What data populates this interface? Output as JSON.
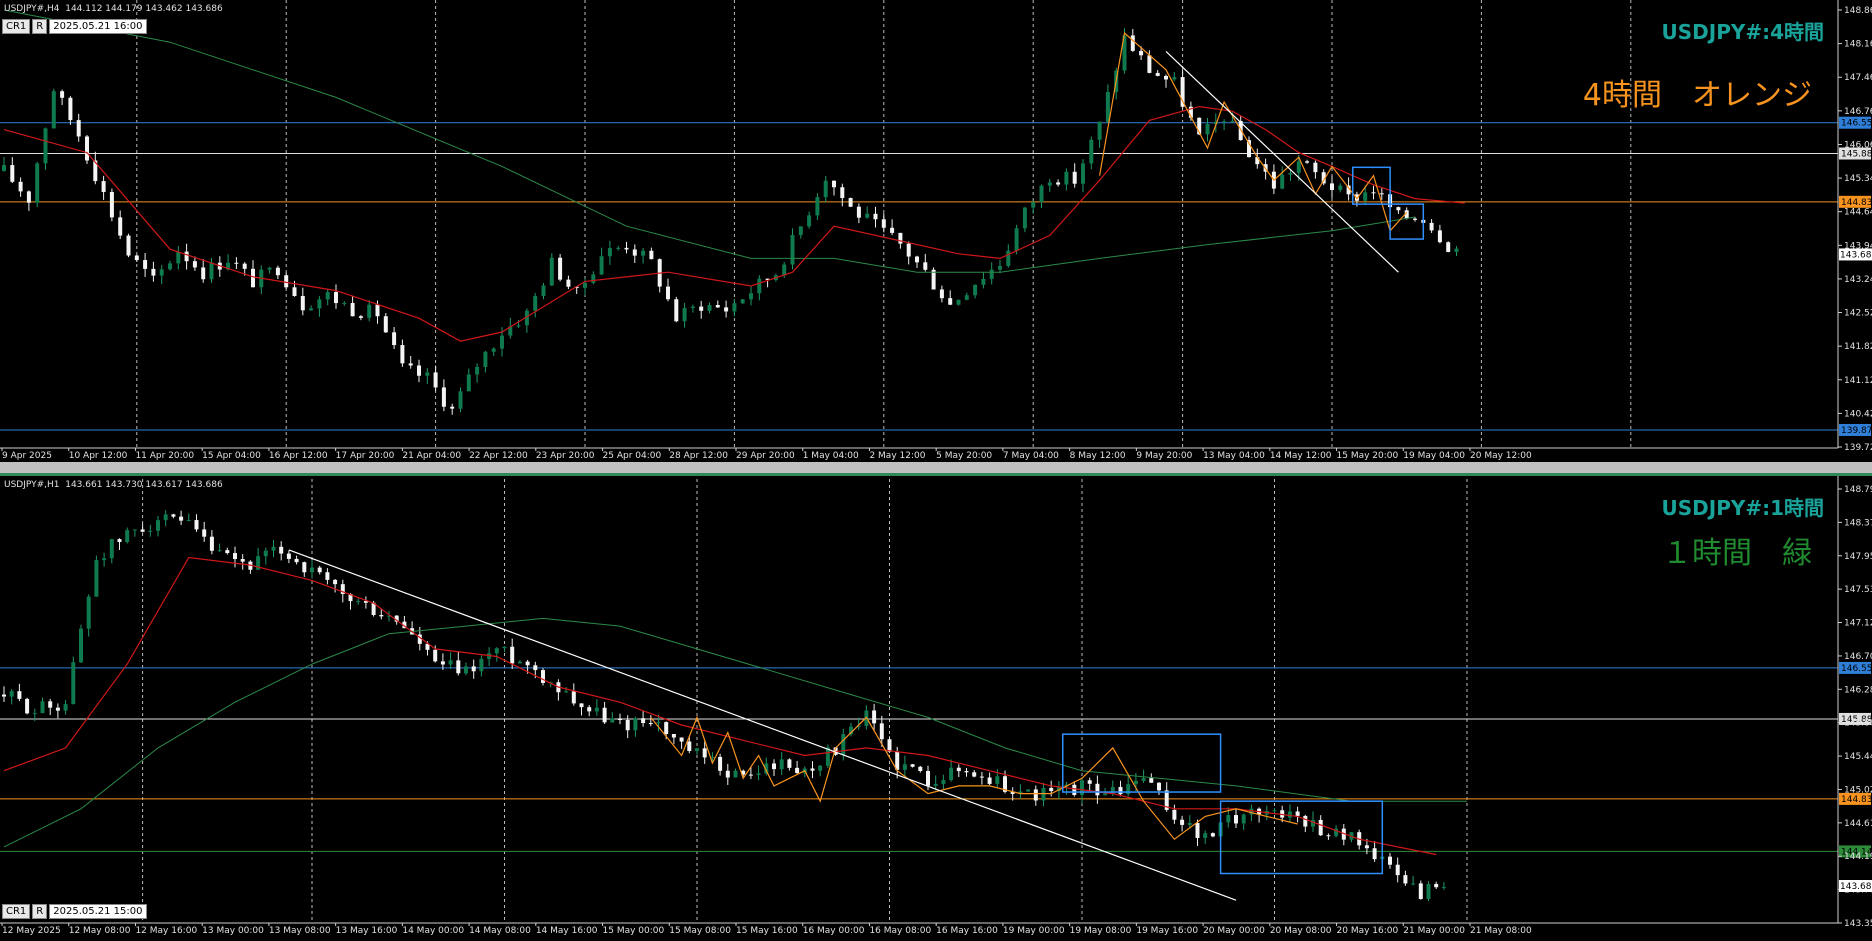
{
  "panels": [
    {
      "id": "h4",
      "header": "USDJPY#,H4  144.112 144.179 143.462 143.686",
      "tag_cr": "CR1",
      "tag_r": "R",
      "tag_datetime": "2025.05.21 16:00",
      "title": "USDJPY#:4時間",
      "note": "4時間　オレンジ",
      "note_color": "#f7931e",
      "chart_data": {
        "type": "candlestick",
        "ylim": [
          139.5,
          149.0
        ],
        "y_ticks": [
          "148.86",
          "148.16",
          "147.46",
          "146.76",
          "146.06",
          "145.34",
          "144.64",
          "143.94",
          "143.24",
          "142.52",
          "141.82",
          "141.12",
          "140.42",
          "139.72"
        ],
        "x_labels": [
          "9 Apr 2025",
          "10 Apr 12:00",
          "11 Apr 20:00",
          "15 Apr 04:00",
          "16 Apr 12:00",
          "17 Apr 20:00",
          "21 Apr 04:00",
          "22 Apr 12:00",
          "23 Apr 20:00",
          "25 Apr 04:00",
          "28 Apr 12:00",
          "29 Apr 20:00",
          "1 May 04:00",
          "2 May 12:00",
          "5 May 20:00",
          "7 May 04:00",
          "8 May 12:00",
          "9 May 20:00",
          "13 May 04:00",
          "14 May 12:00",
          "15 May 20:00",
          "19 May 04:00",
          "20 May 12:00"
        ],
        "hlines": [
          {
            "price": 146.55,
            "label": "146.55",
            "color": "#2f7fd8"
          },
          {
            "price": 145.88,
            "label": "145.88",
            "color": "#e0e0e0"
          },
          {
            "price": 144.83,
            "label": "144.83",
            "color": "#f7931e"
          },
          {
            "price": 139.87,
            "label": "139.87",
            "color": "#2f7fd8"
          }
        ],
        "last_price": {
          "price": 143.686,
          "label": "143.686"
        },
        "close_path": [
          [
            0,
            145.5
          ],
          [
            3,
            144.9
          ],
          [
            6,
            147.3
          ],
          [
            9,
            146.3
          ],
          [
            12,
            145.0
          ],
          [
            15,
            143.7
          ],
          [
            18,
            143.1
          ],
          [
            21,
            143.8
          ],
          [
            24,
            143.3
          ],
          [
            27,
            143.6
          ],
          [
            30,
            143.1
          ],
          [
            33,
            143.4
          ],
          [
            36,
            142.6
          ],
          [
            39,
            142.8
          ],
          [
            42,
            142.5
          ],
          [
            45,
            142.4
          ],
          [
            48,
            141.2
          ],
          [
            51,
            141.0
          ],
          [
            54,
            140.3
          ],
          [
            57,
            141.3
          ],
          [
            60,
            142.0
          ],
          [
            63,
            142.4
          ],
          [
            66,
            143.5
          ],
          [
            69,
            142.8
          ],
          [
            72,
            143.7
          ],
          [
            75,
            143.9
          ],
          [
            78,
            143.5
          ],
          [
            81,
            142.3
          ],
          [
            84,
            142.6
          ],
          [
            87,
            142.5
          ],
          [
            90,
            142.9
          ],
          [
            93,
            143.3
          ],
          [
            96,
            144.3
          ],
          [
            99,
            145.4
          ],
          [
            102,
            144.7
          ],
          [
            105,
            144.3
          ],
          [
            108,
            143.9
          ],
          [
            111,
            143.3
          ],
          [
            114,
            142.6
          ],
          [
            117,
            143.1
          ],
          [
            120,
            143.5
          ],
          [
            123,
            144.6
          ],
          [
            126,
            145.4
          ],
          [
            129,
            145.3
          ],
          [
            132,
            146.5
          ],
          [
            135,
            148.4
          ],
          [
            138,
            147.7
          ],
          [
            141,
            147.4
          ],
          [
            144,
            146.2
          ],
          [
            147,
            146.7
          ],
          [
            150,
            145.9
          ],
          [
            153,
            145.2
          ],
          [
            156,
            145.7
          ],
          [
            159,
            145.3
          ],
          [
            162,
            144.9
          ],
          [
            165,
            145.1
          ],
          [
            168,
            144.5
          ],
          [
            171,
            144.5
          ],
          [
            174,
            143.9
          ],
          [
            176,
            143.7
          ]
        ],
        "ema_red": [
          [
            0,
            146.4
          ],
          [
            10,
            145.9
          ],
          [
            20,
            143.8
          ],
          [
            30,
            143.2
          ],
          [
            40,
            142.9
          ],
          [
            50,
            142.3
          ],
          [
            55,
            141.8
          ],
          [
            60,
            142.0
          ],
          [
            70,
            143.1
          ],
          [
            80,
            143.3
          ],
          [
            90,
            143.0
          ],
          [
            95,
            143.3
          ],
          [
            100,
            144.3
          ],
          [
            110,
            143.9
          ],
          [
            115,
            143.7
          ],
          [
            120,
            143.6
          ],
          [
            126,
            144.1
          ],
          [
            132,
            145.3
          ],
          [
            138,
            146.6
          ],
          [
            144,
            146.9
          ],
          [
            148,
            146.8
          ],
          [
            152,
            146.4
          ],
          [
            156,
            145.9
          ],
          [
            160,
            145.6
          ],
          [
            165,
            145.2
          ],
          [
            170,
            144.9
          ],
          [
            176,
            144.8
          ]
        ],
        "sma_green": [
          [
            0,
            149.0
          ],
          [
            20,
            148.3
          ],
          [
            40,
            147.1
          ],
          [
            60,
            145.6
          ],
          [
            75,
            144.3
          ],
          [
            90,
            143.6
          ],
          [
            100,
            143.6
          ],
          [
            110,
            143.3
          ],
          [
            120,
            143.3
          ],
          [
            132,
            143.6
          ],
          [
            145,
            143.9
          ],
          [
            160,
            144.2
          ],
          [
            170,
            144.5
          ]
        ],
        "trendline": [
          [
            140,
            148.1
          ],
          [
            168,
            143.3
          ]
        ],
        "zigzag": [
          [
            132,
            145.4
          ],
          [
            135,
            148.5
          ],
          [
            140,
            147.7
          ],
          [
            145,
            146.0
          ],
          [
            147,
            147.0
          ],
          [
            151,
            145.8
          ],
          [
            153,
            145.3
          ],
          [
            156,
            145.8
          ],
          [
            158,
            145.0
          ],
          [
            160,
            145.6
          ],
          [
            163,
            144.9
          ],
          [
            165,
            145.4
          ],
          [
            167,
            144.2
          ],
          [
            169,
            144.6
          ]
        ],
        "boxes": [
          {
            "x0": 162.5,
            "x1": 167.0,
            "y0": 145.58,
            "y1": 144.78
          },
          {
            "x0": 167.0,
            "x1": 171.0,
            "y0": 144.78,
            "y1": 144.02
          }
        ],
        "vgrid_indices": [
          16,
          34,
          52,
          70,
          88,
          106,
          124,
          142,
          160,
          178,
          196
        ]
      }
    },
    {
      "id": "h1",
      "header": "USDJPY#,H1  143.661 143.730 143.617 143.686",
      "tag_cr": "CR1",
      "tag_r": "R",
      "tag_datetime": "2025.05.21 15:00",
      "title": "USDJPY#:1時間",
      "note": "１時間　緑",
      "note_color": "#1f8a2e",
      "chart_data": {
        "type": "candlestick",
        "ylim": [
          143.2,
          148.9
        ],
        "y_ticks": [
          "148.79",
          "148.37",
          "147.95",
          "147.53",
          "147.12",
          "146.70",
          "146.28",
          "145.86",
          "145.44",
          "145.02",
          "144.61",
          "144.19",
          "143.77",
          "143.35"
        ],
        "x_labels": [
          "12 May 2025",
          "12 May 08:00",
          "12 May 16:00",
          "13 May 00:00",
          "13 May 08:00",
          "13 May 16:00",
          "14 May 00:00",
          "14 May 08:00",
          "14 May 16:00",
          "15 May 00:00",
          "15 May 08:00",
          "15 May 16:00",
          "16 May 00:00",
          "16 May 08:00",
          "16 May 16:00",
          "19 May 00:00",
          "19 May 08:00",
          "19 May 16:00",
          "20 May 00:00",
          "20 May 08:00",
          "20 May 16:00",
          "21 May 00:00",
          "21 May 08:00"
        ],
        "hlines": [
          {
            "price": 146.55,
            "label": "146.55",
            "color": "#2f7fd8"
          },
          {
            "price": 145.88,
            "label": "145.88",
            "color": "#e0e0e0"
          },
          {
            "price": 144.83,
            "label": "144.83",
            "color": "#f7931e"
          },
          {
            "price": 144.14,
            "label": "144.14",
            "color": "#2e8b3a"
          }
        ],
        "last_price": {
          "price": 143.686,
          "label": "143.686"
        },
        "close_path": [
          [
            0,
            146.2
          ],
          [
            4,
            146.0
          ],
          [
            8,
            146.1
          ],
          [
            12,
            148.0
          ],
          [
            16,
            148.3
          ],
          [
            20,
            148.5
          ],
          [
            24,
            148.4
          ],
          [
            28,
            148.0
          ],
          [
            32,
            147.9
          ],
          [
            36,
            148.1
          ],
          [
            40,
            147.8
          ],
          [
            44,
            147.5
          ],
          [
            48,
            147.3
          ],
          [
            52,
            147.1
          ],
          [
            56,
            146.6
          ],
          [
            60,
            146.5
          ],
          [
            64,
            146.8
          ],
          [
            68,
            146.6
          ],
          [
            72,
            146.3
          ],
          [
            76,
            146.0
          ],
          [
            80,
            145.8
          ],
          [
            84,
            145.9
          ],
          [
            88,
            145.5
          ],
          [
            92,
            145.3
          ],
          [
            96,
            145.1
          ],
          [
            100,
            145.3
          ],
          [
            104,
            145.2
          ],
          [
            108,
            145.5
          ],
          [
            112,
            145.9
          ],
          [
            116,
            145.3
          ],
          [
            120,
            145.1
          ],
          [
            124,
            145.2
          ],
          [
            128,
            145.1
          ],
          [
            132,
            144.9
          ],
          [
            136,
            144.9
          ],
          [
            140,
            145.0
          ],
          [
            144,
            144.9
          ],
          [
            148,
            145.1
          ],
          [
            152,
            144.6
          ],
          [
            156,
            144.3
          ],
          [
            160,
            144.6
          ],
          [
            164,
            144.7
          ],
          [
            168,
            144.6
          ],
          [
            172,
            144.4
          ],
          [
            176,
            144.3
          ],
          [
            180,
            143.9
          ],
          [
            184,
            143.6
          ],
          [
            188,
            143.8
          ]
        ],
        "ema_red": [
          [
            0,
            145.2
          ],
          [
            8,
            145.5
          ],
          [
            16,
            146.6
          ],
          [
            24,
            148.0
          ],
          [
            32,
            147.9
          ],
          [
            40,
            147.7
          ],
          [
            48,
            147.4
          ],
          [
            56,
            146.8
          ],
          [
            64,
            146.7
          ],
          [
            72,
            146.3
          ],
          [
            80,
            146.1
          ],
          [
            88,
            145.8
          ],
          [
            96,
            145.6
          ],
          [
            104,
            145.4
          ],
          [
            112,
            145.5
          ],
          [
            120,
            145.4
          ],
          [
            128,
            145.2
          ],
          [
            136,
            145.0
          ],
          [
            144,
            144.9
          ],
          [
            152,
            144.7
          ],
          [
            160,
            144.7
          ],
          [
            168,
            144.6
          ],
          [
            176,
            144.3
          ],
          [
            186,
            144.1
          ]
        ],
        "sma_green": [
          [
            0,
            144.2
          ],
          [
            10,
            144.7
          ],
          [
            20,
            145.5
          ],
          [
            30,
            146.1
          ],
          [
            40,
            146.6
          ],
          [
            50,
            147.0
          ],
          [
            60,
            147.1
          ],
          [
            70,
            147.2
          ],
          [
            80,
            147.1
          ],
          [
            90,
            146.8
          ],
          [
            100,
            146.5
          ],
          [
            110,
            146.2
          ],
          [
            120,
            145.9
          ],
          [
            130,
            145.5
          ],
          [
            140,
            145.2
          ],
          [
            150,
            145.1
          ],
          [
            160,
            145.0
          ],
          [
            175,
            144.8
          ],
          [
            190,
            144.8
          ]
        ],
        "trendline": [
          [
            37,
            148.1
          ],
          [
            160,
            143.5
          ]
        ],
        "zigzag": [
          [
            84,
            145.9
          ],
          [
            88,
            145.4
          ],
          [
            90,
            145.9
          ],
          [
            92,
            145.3
          ],
          [
            94,
            145.7
          ],
          [
            96,
            145.1
          ],
          [
            98,
            145.4
          ],
          [
            100,
            145.0
          ],
          [
            104,
            145.2
          ],
          [
            106,
            144.8
          ],
          [
            108,
            145.5
          ],
          [
            112,
            145.9
          ],
          [
            116,
            145.2
          ],
          [
            120,
            144.9
          ],
          [
            124,
            145.0
          ],
          [
            128,
            145.0
          ],
          [
            132,
            144.9
          ],
          [
            136,
            144.9
          ],
          [
            140,
            145.1
          ],
          [
            144,
            145.5
          ],
          [
            148,
            144.8
          ],
          [
            152,
            144.3
          ],
          [
            156,
            144.6
          ],
          [
            160,
            144.7
          ],
          [
            164,
            144.6
          ],
          [
            168,
            144.5
          ]
        ],
        "boxes": [
          {
            "x0": 137.5,
            "x1": 158.0,
            "y0": 145.68,
            "y1": 144.92
          },
          {
            "x0": 158.0,
            "x1": 179.0,
            "y0": 144.8,
            "y1": 143.85
          }
        ],
        "vgrid_indices": [
          18,
          40,
          65,
          90,
          115,
          140,
          165,
          190
        ]
      }
    }
  ]
}
